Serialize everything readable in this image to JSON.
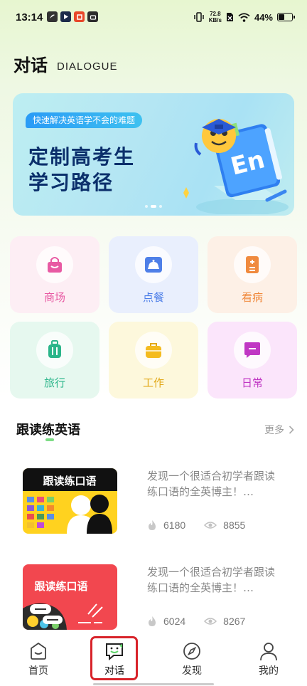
{
  "status_bar": {
    "time": "13:14",
    "net_speed_value": "72.8",
    "net_speed_unit": "KB/s",
    "battery": "44%",
    "battery_level": 0.44
  },
  "header": {
    "title": "对话",
    "subtitle": "DIALOGUE"
  },
  "banner": {
    "tag": "快速解决英语学不会的难题",
    "headline_line1": "定制高考生",
    "headline_line2": "学习路径",
    "book_text": "En"
  },
  "categories": [
    {
      "label": "商场",
      "icon": "shopping-bag-icon",
      "color": "#e85aa3",
      "bg": "#fdeef4"
    },
    {
      "label": "点餐",
      "icon": "food-cloche-icon",
      "color": "#4e7fe8",
      "bg": "#e9effd"
    },
    {
      "label": "看病",
      "icon": "medical-kit-icon",
      "color": "#f08a3e",
      "bg": "#fdf0e6"
    },
    {
      "label": "旅行",
      "icon": "luggage-icon",
      "color": "#2bb58a",
      "bg": "#e6f8ef"
    },
    {
      "label": "工作",
      "icon": "briefcase-icon",
      "color": "#e2a818",
      "bg": "#fdf8dc"
    },
    {
      "label": "日常",
      "icon": "chat-bubble-icon",
      "color": "#c037c4",
      "bg": "#fbe5fb"
    }
  ],
  "section": {
    "title": "跟读练英语",
    "more": "更多"
  },
  "items": [
    {
      "thumb_title": "跟读练口语",
      "desc": "发现一个很适合初学者跟读练口语的全英博主！…",
      "likes": "6180",
      "views": "8855"
    },
    {
      "thumb_title": "跟读练口语",
      "desc": "发现一个很适合初学者跟读练口语的全英博主！…",
      "likes": "6024",
      "views": "8267"
    }
  ],
  "nav": [
    {
      "label": "首页",
      "icon": "home-face-icon"
    },
    {
      "label": "对话",
      "icon": "chat-smile-icon"
    },
    {
      "label": "发现",
      "icon": "compass-icon"
    },
    {
      "label": "我的",
      "icon": "profile-icon"
    }
  ]
}
